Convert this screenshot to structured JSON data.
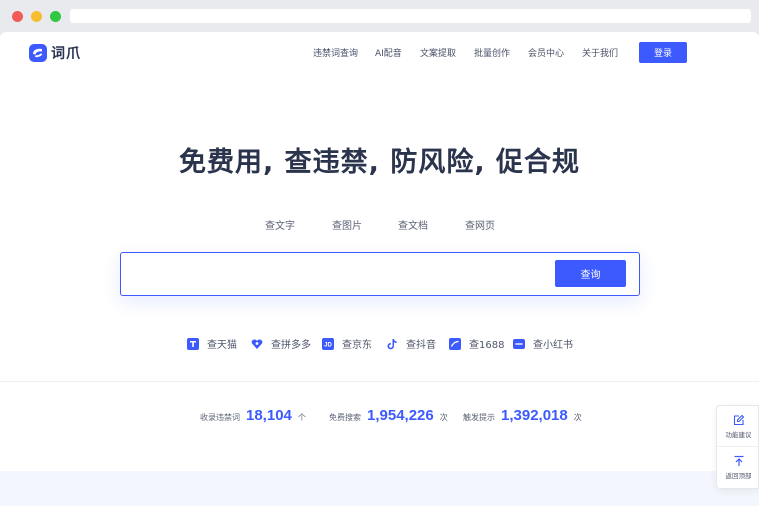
{
  "brand": {
    "name": "词爪",
    "color": "#3d5afe"
  },
  "nav": {
    "links": [
      "违禁词查询",
      "AI配音",
      "文案提取",
      "批量创作",
      "会员中心",
      "关于我们"
    ],
    "login": "登录"
  },
  "hero": {
    "headline": "免费用, 查违禁, 防风险, 促合规"
  },
  "tabs": [
    "查文字",
    "查图片",
    "查文档",
    "查网页"
  ],
  "search": {
    "placeholder": "",
    "button": "查询"
  },
  "platforms": [
    {
      "label": "查天猫",
      "icon": "tmall-icon"
    },
    {
      "label": "查拼多多",
      "icon": "pinduoduo-icon"
    },
    {
      "label": "查京东",
      "icon": "jd-icon"
    },
    {
      "label": "查抖音",
      "icon": "douyin-icon"
    },
    {
      "label": "查1688",
      "icon": "1688-icon"
    },
    {
      "label": "查小红书",
      "icon": "xiaohongshu-icon"
    }
  ],
  "stats": [
    {
      "label": "收录违禁词",
      "value": "18,104",
      "unit": "个"
    },
    {
      "label": "免费搜索",
      "value": "1,954,226",
      "unit": "次"
    },
    {
      "label": "触发提示",
      "value": "1,392,018",
      "unit": "次"
    }
  ],
  "side": {
    "feedback": "功能建议",
    "top": "返回顶部"
  }
}
